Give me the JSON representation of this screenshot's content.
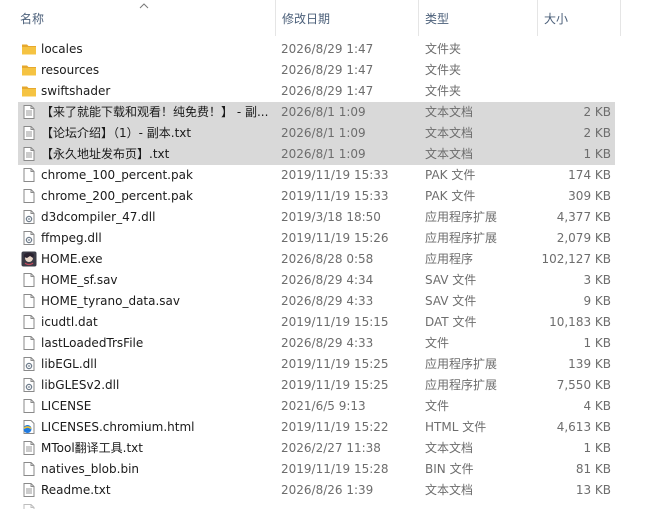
{
  "columns": {
    "name": "名称",
    "date": "修改日期",
    "type": "类型",
    "size": "大小"
  },
  "files": [
    {
      "name": "locales",
      "date": "2026/8/29 1:47",
      "type": "文件夹",
      "size": "",
      "icon": "folder-icon",
      "selected": false
    },
    {
      "name": "resources",
      "date": "2026/8/29 1:47",
      "type": "文件夹",
      "size": "",
      "icon": "folder-icon",
      "selected": false
    },
    {
      "name": "swiftshader",
      "date": "2026/8/29 1:47",
      "type": "文件夹",
      "size": "",
      "icon": "folder-icon",
      "selected": false
    },
    {
      "name": "【来了就能下载和观看！纯免费！】 - 副...",
      "date": "2026/8/1 1:09",
      "type": "文本文档",
      "size": "2 KB",
      "icon": "text-file-icon",
      "selected": true
    },
    {
      "name": "【论坛介绍】（1）- 副本.txt",
      "date": "2026/8/1 1:09",
      "type": "文本文档",
      "size": "2 KB",
      "icon": "text-file-icon",
      "selected": true
    },
    {
      "name": "【永久地址发布页】.txt",
      "date": "2026/8/1 1:09",
      "type": "文本文档",
      "size": "1 KB",
      "icon": "text-file-icon",
      "selected": true
    },
    {
      "name": "chrome_100_percent.pak",
      "date": "2019/11/19 15:33",
      "type": "PAK 文件",
      "size": "174 KB",
      "icon": "file-icon",
      "selected": false
    },
    {
      "name": "chrome_200_percent.pak",
      "date": "2019/11/19 15:33",
      "type": "PAK 文件",
      "size": "309 KB",
      "icon": "file-icon",
      "selected": false
    },
    {
      "name": "d3dcompiler_47.dll",
      "date": "2019/3/18 18:50",
      "type": "应用程序扩展",
      "size": "4,377 KB",
      "icon": "dll-icon",
      "selected": false
    },
    {
      "name": "ffmpeg.dll",
      "date": "2019/11/19 15:26",
      "type": "应用程序扩展",
      "size": "2,079 KB",
      "icon": "dll-icon",
      "selected": false
    },
    {
      "name": "HOME.exe",
      "date": "2026/8/28 0:58",
      "type": "应用程序",
      "size": "102,127 KB",
      "icon": "app-icon",
      "selected": false
    },
    {
      "name": "HOME_sf.sav",
      "date": "2026/8/29 4:34",
      "type": "SAV 文件",
      "size": "3 KB",
      "icon": "file-icon",
      "selected": false
    },
    {
      "name": "HOME_tyrano_data.sav",
      "date": "2026/8/29 4:33",
      "type": "SAV 文件",
      "size": "9 KB",
      "icon": "file-icon",
      "selected": false
    },
    {
      "name": "icudtl.dat",
      "date": "2019/11/19 15:15",
      "type": "DAT 文件",
      "size": "10,183 KB",
      "icon": "file-icon",
      "selected": false
    },
    {
      "name": "lastLoadedTrsFile",
      "date": "2026/8/29 4:33",
      "type": "文件",
      "size": "1 KB",
      "icon": "file-icon",
      "selected": false
    },
    {
      "name": "libEGL.dll",
      "date": "2019/11/19 15:25",
      "type": "应用程序扩展",
      "size": "139 KB",
      "icon": "dll-icon",
      "selected": false
    },
    {
      "name": "libGLESv2.dll",
      "date": "2019/11/19 15:25",
      "type": "应用程序扩展",
      "size": "7,550 KB",
      "icon": "dll-icon",
      "selected": false
    },
    {
      "name": "LICENSE",
      "date": "2021/6/5 9:13",
      "type": "文件",
      "size": "4 KB",
      "icon": "file-icon",
      "selected": false
    },
    {
      "name": "LICENSES.chromium.html",
      "date": "2019/11/19 15:22",
      "type": "HTML 文件",
      "size": "4,613 KB",
      "icon": "html-file-icon",
      "selected": false
    },
    {
      "name": "MTool翻译工具.txt",
      "date": "2026/2/27 11:38",
      "type": "文本文档",
      "size": "1 KB",
      "icon": "text-file-icon",
      "selected": false
    },
    {
      "name": "natives_blob.bin",
      "date": "2019/11/19 15:28",
      "type": "BIN 文件",
      "size": "81 KB",
      "icon": "file-icon",
      "selected": false
    },
    {
      "name": "Readme.txt",
      "date": "2026/8/26 1:39",
      "type": "文本文档",
      "size": "13 KB",
      "icon": "text-file-icon",
      "selected": false
    }
  ],
  "colors": {
    "folder": "#f5c342",
    "selection": "#d9d9d9",
    "header_text": "#4c607a",
    "detail_text": "#6d6d6d"
  }
}
